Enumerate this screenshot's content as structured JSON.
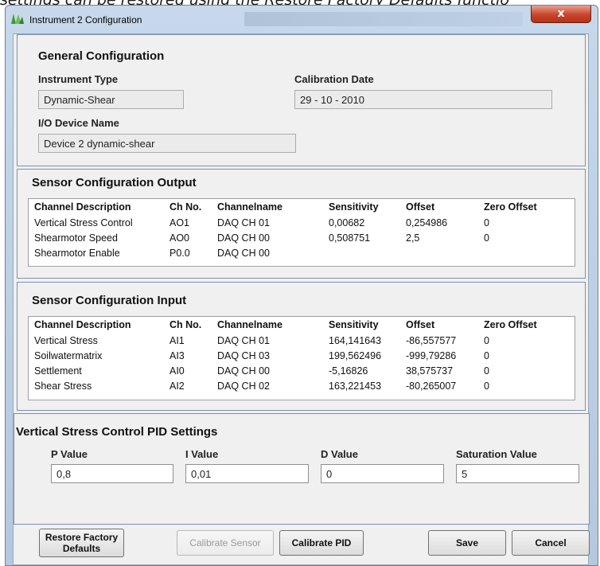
{
  "background_caption": "settings can be restored using the Restore Factory Defaults functio",
  "window": {
    "title": "Instrument 2 Configuration",
    "close_glyph": "x"
  },
  "general": {
    "heading": "General Configuration",
    "instrument_type_label": "Instrument Type",
    "instrument_type_value": "Dynamic-Shear",
    "calibration_date_label": "Calibration Date",
    "calibration_date_value": "29 - 10 - 2010",
    "io_device_label": "I/O Device Name",
    "io_device_value": "Device 2 dynamic-shear"
  },
  "columns": [
    "Channel Description",
    "Ch No.",
    "Channelname",
    "Sensitivity",
    "Offset",
    "Zero Offset"
  ],
  "sensor_output": {
    "heading": "Sensor Configuration Output",
    "rows": [
      [
        "Vertical Stress Control",
        "AO1",
        "DAQ CH 01",
        "0,00682",
        "0,254986",
        "0"
      ],
      [
        "Shearmotor Speed",
        "AO0",
        "DAQ CH 00",
        "0,508751",
        "2,5",
        "0"
      ],
      [
        "Shearmotor Enable",
        "P0.0",
        "DAQ CH 00",
        "",
        "",
        ""
      ]
    ]
  },
  "sensor_input": {
    "heading": "Sensor Configuration Input",
    "rows": [
      [
        "Vertical Stress",
        "AI1",
        "DAQ CH 01",
        "164,141643",
        "-86,557577",
        "0"
      ],
      [
        "Soilwatermatrix",
        "AI3",
        "DAQ CH 03",
        "199,562496",
        "-999,79286",
        "0"
      ],
      [
        "Settlement",
        "AI0",
        "DAQ CH 00",
        "-5,16826",
        "38,575737",
        "0"
      ],
      [
        "Shear Stress",
        "AI2",
        "DAQ CH 02",
        "163,221453",
        "-80,265007",
        "0"
      ]
    ]
  },
  "pid": {
    "heading": "Vertical Stress Control PID Settings",
    "p_label": "P Value",
    "p_value": "0,8",
    "i_label": "I Value",
    "i_value": "0,01",
    "d_label": "D Value",
    "d_value": "0",
    "sat_label": "Saturation Value",
    "sat_value": "5"
  },
  "buttons": {
    "restore_line1": "Restore Factory",
    "restore_line2": "Defaults",
    "calibrate_sensor": "Calibrate Sensor",
    "calibrate_pid": "Calibrate PID",
    "save": "Save",
    "cancel": "Cancel"
  }
}
